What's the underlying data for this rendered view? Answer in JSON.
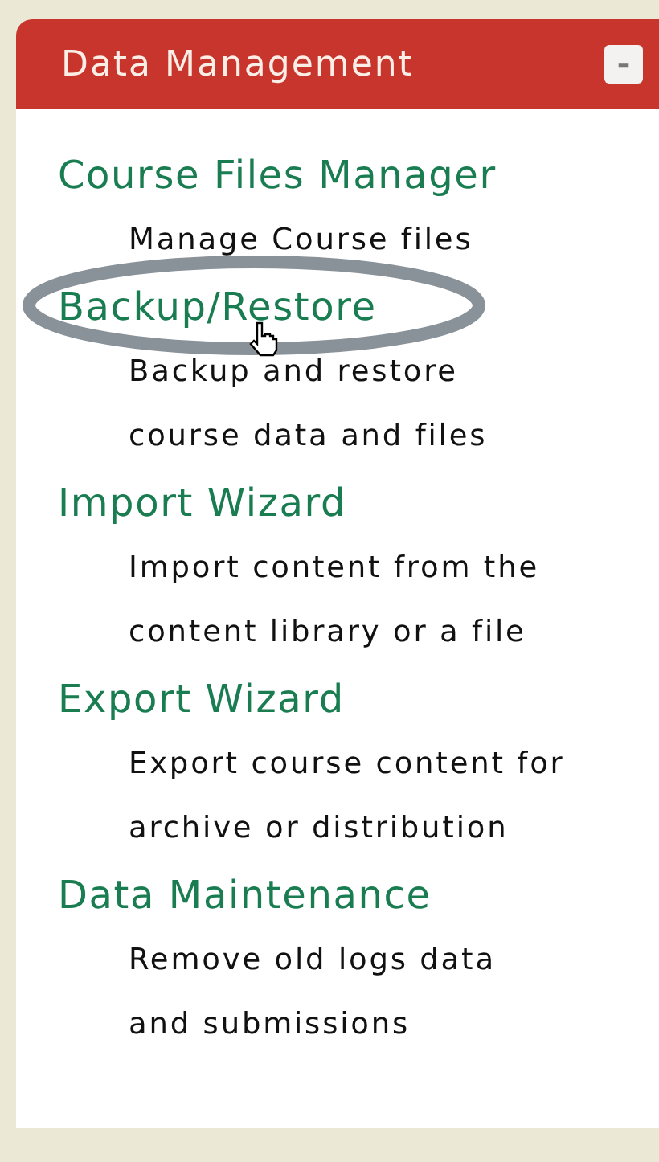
{
  "panel": {
    "title": "Data Management",
    "collapse_button": "–"
  },
  "items": [
    {
      "label": "Course Files Manager",
      "description": [
        "Manage Course files"
      ],
      "highlighted": false
    },
    {
      "label": "Backup/Restore",
      "description": [
        "Backup and restore",
        "course data and files"
      ],
      "highlighted": true
    },
    {
      "label": "Import Wizard",
      "description": [
        "Import content from the",
        "content library or a file"
      ],
      "highlighted": false
    },
    {
      "label": "Export Wizard",
      "description": [
        "Export course content for",
        "archive or distribution"
      ],
      "highlighted": false
    },
    {
      "label": "Data Maintenance",
      "description": [
        "Remove old logs data",
        "and submissions"
      ],
      "highlighted": false
    }
  ]
}
